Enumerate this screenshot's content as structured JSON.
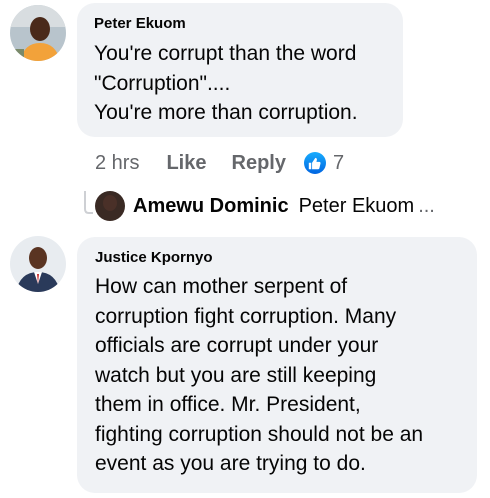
{
  "comments": [
    {
      "author": "Peter Ekuom",
      "text": "You're corrupt than the word\n\"Corruption\"....\nYou're more than corruption.",
      "time": "2 hrs",
      "like_label": "Like",
      "reply_label": "Reply",
      "reaction_icon": "thumbs-up-icon",
      "reaction_count": "7"
    },
    {
      "author": "Justice Kpornyo",
      "text": "How can mother serpent of\ncorruption fight corruption. Many\nofficials are corrupt under your\nwatch but you are still keeping\nthem in office.  Mr. President,\nfighting corruption should not be an\nevent as you are trying to do."
    }
  ],
  "reply_thread": {
    "author": "Amewu Dominic",
    "preview": "Peter Ekuom",
    "ellipsis": "..."
  },
  "colors": {
    "bubble": "#f0f2f5",
    "meta_text": "#65676b",
    "like_blue": "#1877f2"
  }
}
